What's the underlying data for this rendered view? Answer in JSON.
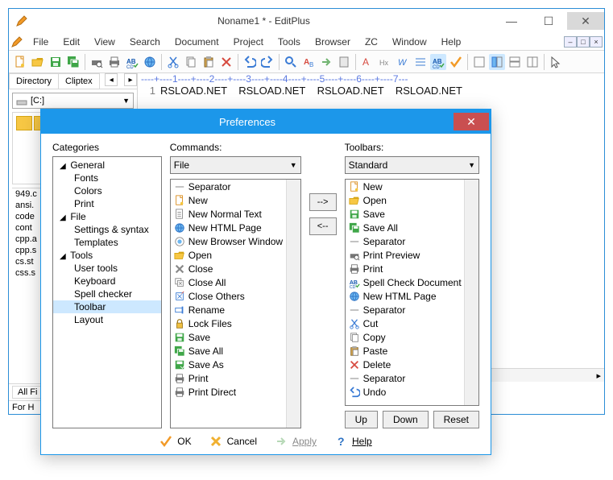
{
  "app": {
    "title": "Noname1 * - EditPlus",
    "menu": [
      "File",
      "Edit",
      "View",
      "Search",
      "Document",
      "Project",
      "Tools",
      "Browser",
      "ZC",
      "Window",
      "Help"
    ],
    "tabs": [
      "Directory",
      "Cliptex"
    ],
    "drive": "[C:]",
    "files": [
      "949.c",
      "ansi.",
      "code",
      "cont",
      "cpp.a",
      "cpp.s",
      "cs.st",
      "css.s"
    ],
    "bottom_tab": "All Fi",
    "status": "For H",
    "ruler": "----+----1----+----2----+----3----+----4----+----5----+----6----+----7---",
    "linenum": "1",
    "code_line": "RSLOAD.NET    RSLOAD.NET    RSLOAD.NET    RSLOAD.NET"
  },
  "dialog": {
    "title": "Preferences",
    "categories_label": "Categories",
    "tree": [
      {
        "label": "General",
        "children": [
          "Fonts",
          "Colors",
          "Print"
        ]
      },
      {
        "label": "File",
        "children": [
          "Settings & syntax",
          "Templates"
        ]
      },
      {
        "label": "Tools",
        "children": [
          "User tools",
          "Keyboard",
          "Spell checker",
          "Toolbar",
          "Layout"
        ]
      }
    ],
    "selected_node": "Toolbar",
    "commands_label": "Commands:",
    "commands_combo": "File",
    "commands_list": [
      {
        "icon": "separator",
        "label": "Separator"
      },
      {
        "icon": "new",
        "label": "New"
      },
      {
        "icon": "newtext",
        "label": "New Normal Text"
      },
      {
        "icon": "html",
        "label": "New HTML Page"
      },
      {
        "icon": "browser",
        "label": "New Browser Window"
      },
      {
        "icon": "open",
        "label": "Open"
      },
      {
        "icon": "close",
        "label": "Close"
      },
      {
        "icon": "closeall",
        "label": "Close All"
      },
      {
        "icon": "closeoth",
        "label": "Close Others"
      },
      {
        "icon": "rename",
        "label": "Rename"
      },
      {
        "icon": "lock",
        "label": "Lock Files"
      },
      {
        "icon": "save",
        "label": "Save"
      },
      {
        "icon": "saveall",
        "label": "Save All"
      },
      {
        "icon": "saveas",
        "label": "Save As"
      },
      {
        "icon": "print",
        "label": "Print"
      },
      {
        "icon": "print",
        "label": "Print Direct"
      }
    ],
    "move_right": "-->",
    "move_left": "<--",
    "toolbars_label": "Toolbars:",
    "toolbars_combo": "Standard",
    "toolbars_list": [
      {
        "icon": "new",
        "label": "New"
      },
      {
        "icon": "open",
        "label": "Open"
      },
      {
        "icon": "save",
        "label": "Save"
      },
      {
        "icon": "saveall",
        "label": "Save All"
      },
      {
        "icon": "separator",
        "label": "Separator"
      },
      {
        "icon": "printprev",
        "label": "Print Preview"
      },
      {
        "icon": "print",
        "label": "Print"
      },
      {
        "icon": "spell",
        "label": "Spell Check Document"
      },
      {
        "icon": "html",
        "label": "New HTML Page"
      },
      {
        "icon": "separator",
        "label": "Separator"
      },
      {
        "icon": "cut",
        "label": "Cut"
      },
      {
        "icon": "copy",
        "label": "Copy"
      },
      {
        "icon": "paste",
        "label": "Paste"
      },
      {
        "icon": "delete",
        "label": "Delete"
      },
      {
        "icon": "separator",
        "label": "Separator"
      },
      {
        "icon": "undo",
        "label": "Undo"
      }
    ],
    "btn_up": "Up",
    "btn_down": "Down",
    "btn_reset": "Reset",
    "btn_ok": "OK",
    "btn_cancel": "Cancel",
    "btn_apply": "Apply",
    "btn_help": "Help"
  },
  "colors": {
    "accent": "#1c97ea",
    "danger": "#c94f50",
    "select": "#cde8ff",
    "folder": "#f7c744",
    "orange": "#f29a27",
    "green": "#3fa648",
    "blue": "#3a7bd5"
  }
}
